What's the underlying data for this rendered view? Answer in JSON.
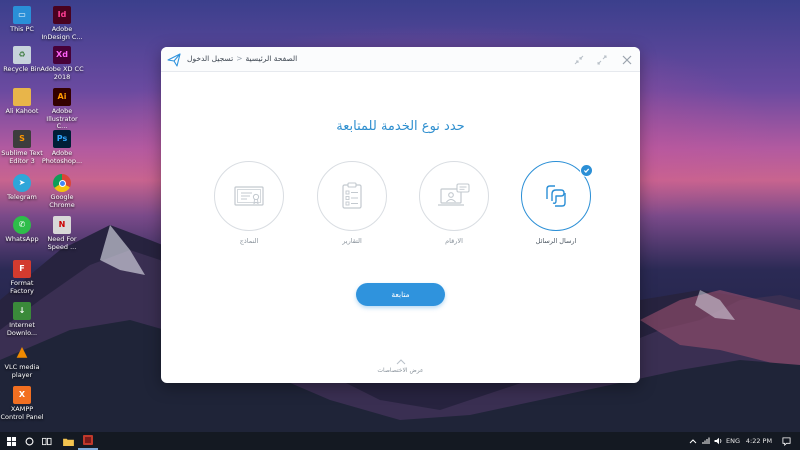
{
  "desktop": {
    "icons": [
      {
        "label": "This PC",
        "icon": "computer-icon",
        "color": "#2a8fd8",
        "glyph": "▭"
      },
      {
        "label": "Adobe InDesign C...",
        "icon": "indesign-icon",
        "color": "#49021f",
        "glyph": "Id"
      },
      {
        "label": "Recycle Bin",
        "icon": "recycle-bin-icon",
        "color": "#c7d3dc",
        "glyph": "♻"
      },
      {
        "label": "Adobe XD CC 2018",
        "icon": "adobe-xd-icon",
        "color": "#470137",
        "glyph": "Xd"
      },
      {
        "label": "Ali Kahoot",
        "icon": "folder-icon",
        "color": "#e8b54a",
        "glyph": ""
      },
      {
        "label": "Adobe Illustrator C...",
        "icon": "illustrator-icon",
        "color": "#330000",
        "glyph": "Ai"
      },
      {
        "label": "Sublime Text Editor 3",
        "icon": "sublime-text-icon",
        "color": "#3d3d3d",
        "glyph": "S"
      },
      {
        "label": "Adobe Photoshop...",
        "icon": "photoshop-icon",
        "color": "#001e36",
        "glyph": "Ps"
      },
      {
        "label": "Telegram",
        "icon": "telegram-icon",
        "color": "#2ea6d9",
        "glyph": "➤"
      },
      {
        "label": "Google Chrome",
        "icon": "chrome-icon",
        "color": "#e9b23a",
        "glyph": "●"
      },
      {
        "label": "WhatsApp",
        "icon": "whatsapp-icon",
        "color": "#2ebd4a",
        "glyph": "✆"
      },
      {
        "label": "Need For Speed ...",
        "icon": "nfs-icon",
        "color": "#d8d8d8",
        "glyph": "N"
      },
      {
        "label": "Format Factory",
        "icon": "format-factory-icon",
        "color": "#d33b2f",
        "glyph": "F"
      },
      {
        "label": "Internet Downlo...",
        "icon": "idm-icon",
        "color": "#3a8a3a",
        "glyph": "↓"
      },
      {
        "label": "VLC media player",
        "icon": "vlc-icon",
        "color": "#f08a00",
        "glyph": "▲"
      },
      {
        "label": "XAMPP Control Panel",
        "icon": "xampp-icon",
        "color": "#f26f21",
        "glyph": "X"
      }
    ]
  },
  "window": {
    "breadcrumb_home": "الصفحة الرئيسية",
    "breadcrumb_separator": "<",
    "breadcrumb_current": "تسجيل الدخول",
    "heading": "حدد نوع الخدمة للمتابعة",
    "options": [
      {
        "label": "ارسال الرسائل",
        "icon": "message-hand-icon",
        "selected": true
      },
      {
        "label": "الارقام",
        "icon": "laptop-chat-icon",
        "selected": false
      },
      {
        "label": "التقارير",
        "icon": "clipboard-report-icon",
        "selected": false
      },
      {
        "label": "النماذج",
        "icon": "certificate-icon",
        "selected": false
      }
    ],
    "continue_label": "متابعة",
    "show_specs_label": "عرض الاختصاصات"
  },
  "taskbar": {
    "language": "ENG",
    "time": "4:22 PM"
  },
  "colors": {
    "accent": "#2f93dd",
    "heading": "#2f8fcf",
    "taskbar": "#141922"
  }
}
